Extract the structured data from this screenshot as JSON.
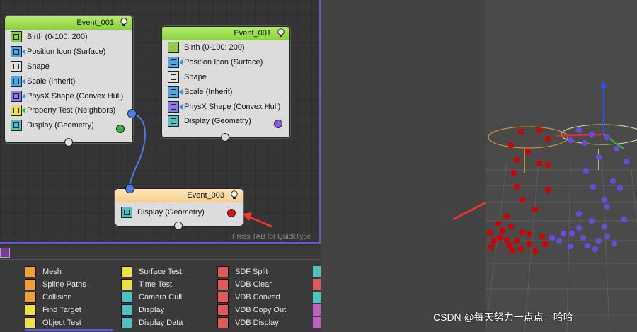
{
  "node_editor": {
    "quicktype_hint": "Press TAB for QuickType",
    "nodes": [
      {
        "title": "Event_001",
        "operators": [
          {
            "label": "Birth (0-100: 200)",
            "icon": "birth-icon"
          },
          {
            "label": "Position Icon (Surface)",
            "icon": "position-icon"
          },
          {
            "label": "Shape",
            "icon": "shape-icon"
          },
          {
            "label": "Scale (Inherit)",
            "icon": "scale-icon"
          },
          {
            "label": "PhysX Shape (Convex Hull)",
            "icon": "physx-shape-icon"
          },
          {
            "label": "Property Test (Neighbors)",
            "icon": "property-test-icon"
          },
          {
            "label": "Display (Geometry)",
            "icon": "display-icon"
          }
        ],
        "display_color": "#3cb043"
      },
      {
        "title": "Event_001",
        "operators": [
          {
            "label": "Birth (0-100: 200)",
            "icon": "birth-icon"
          },
          {
            "label": "Position Icon (Surface)",
            "icon": "position-icon"
          },
          {
            "label": "Shape",
            "icon": "shape-icon"
          },
          {
            "label": "Scale (Inherit)",
            "icon": "scale-icon"
          },
          {
            "label": "PhysX Shape (Convex Hull)",
            "icon": "physx-shape-icon"
          },
          {
            "label": "Display (Geometry)",
            "icon": "display-icon"
          }
        ],
        "display_color": "#8a5be8"
      },
      {
        "title": "Event_003",
        "operators": [
          {
            "label": "Display (Geometry)",
            "icon": "display-icon"
          }
        ],
        "display_color": "#e01010"
      }
    ]
  },
  "depot": {
    "columns": [
      [
        {
          "label": "Mesh",
          "icon": "mesh-icon",
          "color": "#f0a030"
        },
        {
          "label": "Spline Paths",
          "icon": "spline-paths-icon",
          "color": "#f0a030"
        },
        {
          "label": "Collision",
          "icon": "collision-icon",
          "color": "#f0a030"
        },
        {
          "label": "Find Target",
          "icon": "find-target-icon",
          "color": "#f0e040"
        },
        {
          "label": "Object Test",
          "icon": "object-test-icon",
          "color": "#f0e040"
        }
      ],
      [
        {
          "label": "Surface Test",
          "icon": "surface-test-icon",
          "color": "#f0e040"
        },
        {
          "label": "Time Test",
          "icon": "time-test-icon",
          "color": "#f0e040"
        },
        {
          "label": "Camera Cull",
          "icon": "camera-cull-icon",
          "color": "#4ec1c1"
        },
        {
          "label": "Display",
          "icon": "display-icon",
          "color": "#4ec1c1"
        },
        {
          "label": "Display Data",
          "icon": "display-data-icon",
          "color": "#4ec1c1"
        }
      ],
      [
        {
          "label": "SDF Split",
          "icon": "sdf-split-icon",
          "color": "#e05a5a"
        },
        {
          "label": "VDB Clear",
          "icon": "vdb-clear-icon",
          "color": "#e05a5a"
        },
        {
          "label": "VDB Convert",
          "icon": "vdb-convert-icon",
          "color": "#e05a5a"
        },
        {
          "label": "VDB Copy Out",
          "icon": "vdb-copy-out-icon",
          "color": "#e05a5a"
        },
        {
          "label": "VDB Display",
          "icon": "vdb-display-icon",
          "color": "#e05a5a"
        }
      ]
    ]
  },
  "viewport": {
    "red_particle_color": "#d00000",
    "purple_particle_color": "#6a4ad8"
  },
  "watermark": "CSDN @每天努力一点点，哈哈"
}
